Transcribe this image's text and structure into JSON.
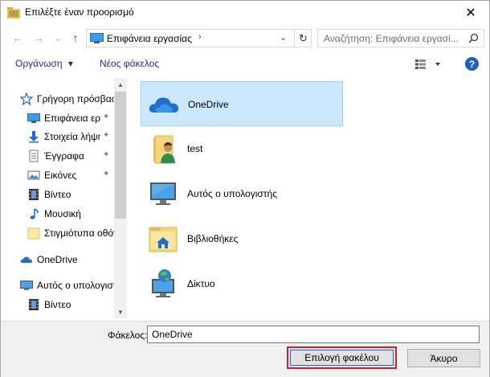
{
  "window": {
    "title": "Επιλέξτε έναν προορισμό",
    "close_glyph": "✕"
  },
  "nav": {
    "back_glyph": "←",
    "forward_glyph": "→",
    "recent_glyph": "⌄",
    "up_glyph": "↑",
    "address_path": "Επιφάνεια εργασίας",
    "address_sep": "›",
    "address_dropdown": "⌄",
    "refresh_glyph": "↻",
    "search_placeholder": "Αναζήτηση: Επιφάνεια εργασί..."
  },
  "toolbar": {
    "organize_label": "Οργάνωση",
    "organize_caret": "▾",
    "new_folder_label": "Νέος φάκελος",
    "help_label": "?"
  },
  "sidebar": {
    "items": [
      {
        "label": "Γρήγορη πρόσβαση",
        "icon": "star-icon",
        "pinned": false
      },
      {
        "label": "Επιφάνεια εργασίας",
        "icon": "desktop-icon",
        "pinned": true
      },
      {
        "label": "Στοιχεία λήψης",
        "icon": "download-icon",
        "pinned": true
      },
      {
        "label": "Έγγραφα",
        "icon": "documents-icon",
        "pinned": true
      },
      {
        "label": "Εικόνες",
        "icon": "pictures-icon",
        "pinned": true
      },
      {
        "label": "Βίντεο",
        "icon": "video-icon",
        "pinned": false
      },
      {
        "label": "Μουσική",
        "icon": "music-icon",
        "pinned": false
      },
      {
        "label": "Στιγμιότυπα οθόνης",
        "icon": "folder-icon",
        "pinned": false
      },
      {
        "label": "OneDrive",
        "icon": "onedrive-icon",
        "pinned": false
      },
      {
        "label": "Αυτός ο υπολογιστής",
        "icon": "computer-icon",
        "pinned": false
      },
      {
        "label": "Βίντεο",
        "icon": "video-icon",
        "pinned": false
      }
    ],
    "pin_glyph": "📌",
    "scroll_up": "▲",
    "scroll_down": "▼"
  },
  "content": {
    "items": [
      {
        "name": "OneDrive",
        "icon": "onedrive-icon",
        "selected": true
      },
      {
        "name": "test",
        "icon": "user-folder-icon",
        "selected": false
      },
      {
        "name": "Αυτός ο υπολογιστής",
        "icon": "computer-icon",
        "selected": false
      },
      {
        "name": "Βιβλιοθήκες",
        "icon": "libraries-icon",
        "selected": false
      },
      {
        "name": "Δίκτυο",
        "icon": "network-icon",
        "selected": false
      }
    ]
  },
  "bottom": {
    "folder_label": "Φάκελος:",
    "folder_value": "OneDrive",
    "select_button": "Επιλογή φακέλου",
    "cancel_button": "Άκυρο"
  },
  "colors": {
    "accent": "#0078d7",
    "highlight_border": "#d0202c",
    "selection_bg": "#cce8ff"
  }
}
